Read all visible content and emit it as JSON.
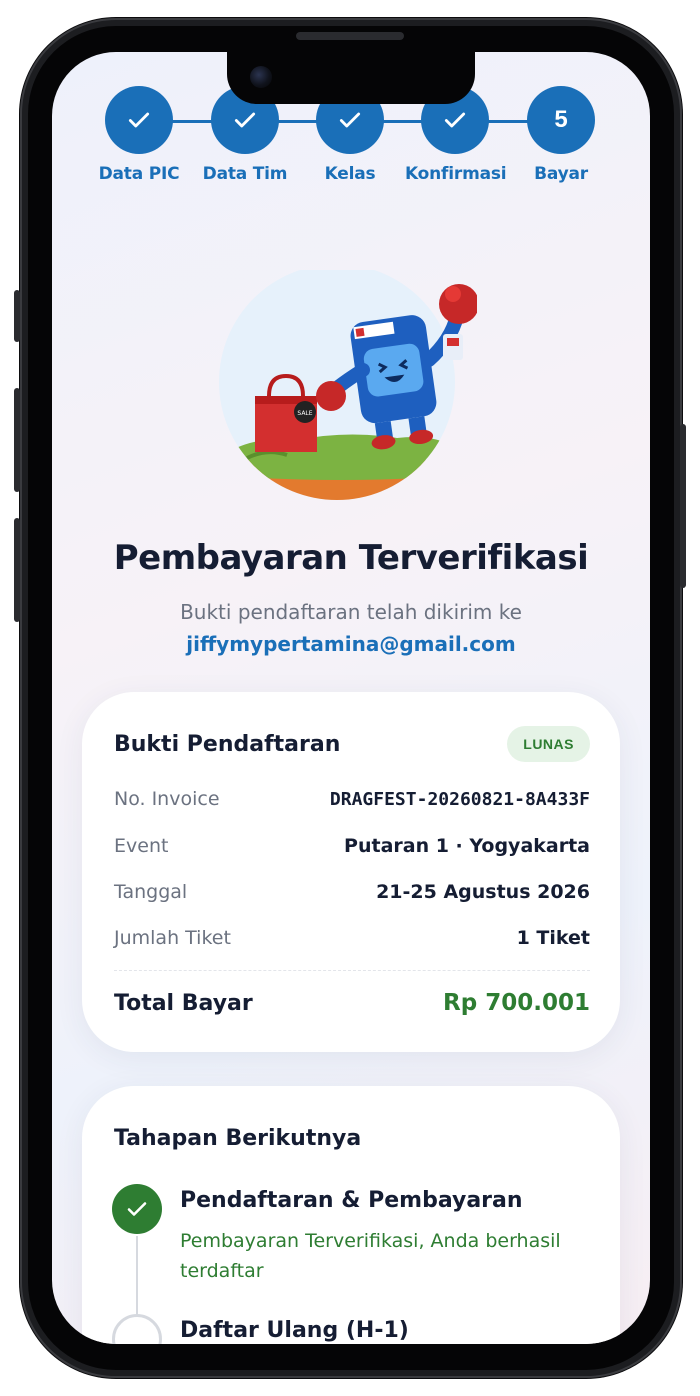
{
  "stepper": {
    "steps": [
      {
        "label": "Data PIC",
        "status": "done",
        "icon": "check-icon"
      },
      {
        "label": "Data Tim",
        "status": "done",
        "icon": "check-icon"
      },
      {
        "label": "Kelas",
        "status": "done",
        "icon": "check-icon"
      },
      {
        "label": "Konfirmasi",
        "status": "done",
        "icon": "check-icon"
      },
      {
        "label": "Bayar",
        "status": "current",
        "number": "5"
      }
    ]
  },
  "hero": {
    "title": "Pembayaran Terverifikasi",
    "subtitle": "Bukti pendaftaran telah dikirim ke",
    "email": "jiffymypertamina@gmail.com"
  },
  "receipt": {
    "title": "Bukti Pendaftaran",
    "badge": "LUNAS",
    "rows": [
      {
        "label": "No. Invoice",
        "value": "DRAGFEST-20260821-8A433F"
      },
      {
        "label": "Event",
        "value": "Putaran 1 · Yogyakarta"
      },
      {
        "label": "Tanggal",
        "value": "21-25 Agustus 2026"
      },
      {
        "label": "Jumlah Tiket",
        "value": "1 Tiket"
      }
    ],
    "total_label": "Total Bayar",
    "total_value": "Rp 700.001"
  },
  "next_steps": {
    "title": "Tahapan Berikutnya",
    "items": [
      {
        "title": "Pendaftaran & Pembayaran",
        "desc": "Pembayaran Terverifikasi, Anda berhasil terdaftar",
        "status": "done"
      },
      {
        "title": "Daftar Ulang (H-1)",
        "desc": "",
        "status": "pending"
      }
    ]
  },
  "colors": {
    "primary": "#1a6fb8",
    "success": "#2e7d32",
    "badge_bg": "#e5f3e6",
    "text_dark": "#151d33",
    "text_muted": "#6b7280"
  }
}
